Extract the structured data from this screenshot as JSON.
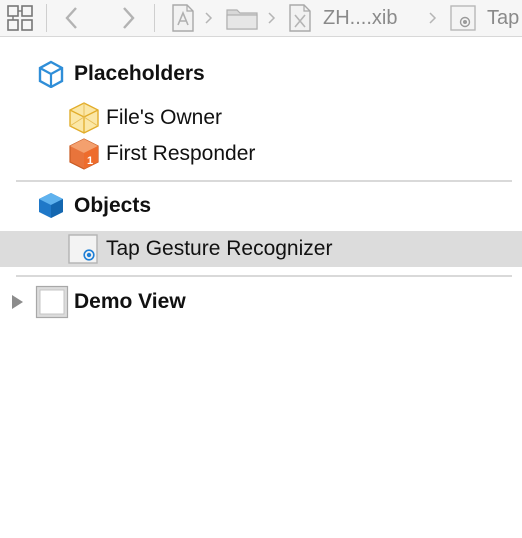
{
  "jumpbar": {
    "file_label": "ZH....xib",
    "last_label": "Tap"
  },
  "outline": {
    "placeholders": {
      "title": "Placeholders",
      "items": [
        {
          "label": "File's Owner"
        },
        {
          "label": "First Responder"
        }
      ]
    },
    "objects": {
      "title": "Objects",
      "items": [
        {
          "label": "Tap Gesture Recognizer",
          "selected": true
        }
      ]
    },
    "demo_view": {
      "label": "Demo View",
      "expanded": false
    }
  },
  "colors": {
    "selection": "#dcdcdc",
    "cube_blue": "#2f8ed8",
    "owner_yellow": "#f3c44b",
    "responder_orange": "#e8743b",
    "gesture_dot": "#1f7fd6"
  }
}
